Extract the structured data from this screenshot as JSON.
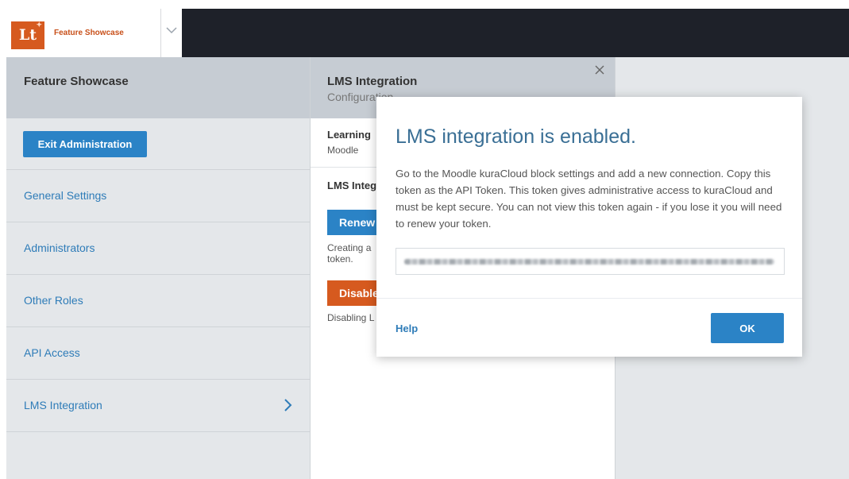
{
  "brand": {
    "logo_text": "Lt",
    "name": "Feature Showcase"
  },
  "left_panel": {
    "title": "Feature Showcase",
    "exit_button": "Exit Administration",
    "items": [
      {
        "label": "General Settings"
      },
      {
        "label": "Administrators"
      },
      {
        "label": "Other Roles"
      },
      {
        "label": "API Access"
      },
      {
        "label": "LMS Integration"
      }
    ]
  },
  "middle_panel": {
    "title": "LMS Integration",
    "subtitle": "Configuration",
    "section1_label": "Learning",
    "section1_value": "Moodle",
    "section2_label": "LMS Integ",
    "renew_button": "Renew",
    "renew_description": "Creating a token.",
    "disable_button": "Disable",
    "disable_description": "Disabling L"
  },
  "modal": {
    "title": "LMS integration is enabled.",
    "body": "Go to the Moodle kuraCloud block settings and add a new connection. Copy this token as the API Token. This token gives administrative access to kuraCloud and must be kept secure. You can not view this token again - if you lose it you will need to renew your token.",
    "help_link": "Help",
    "ok_button": "OK"
  },
  "colors": {
    "primary": "#2b83c6",
    "danger": "#d65a1f",
    "topbar": "#1e2129",
    "link": "#2e7cb8",
    "modal_title": "#3a6f95"
  }
}
